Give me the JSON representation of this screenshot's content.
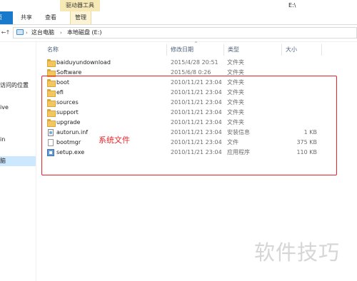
{
  "window": {
    "title": "E:\\",
    "contextual_group": "驱动器工具"
  },
  "ribbon": {
    "tabs": [
      {
        "label": "页"
      },
      {
        "label": "共享"
      },
      {
        "label": "查看"
      },
      {
        "label": "管理"
      }
    ],
    "colors": {
      "file_tab": "#1979ca",
      "contextual": "#f6e9b5"
    }
  },
  "address": {
    "back_arrow": "←",
    "up_arrow": "↑",
    "crumbs": [
      "这台电脑",
      "本地磁盘 (E:)"
    ]
  },
  "nav_pane": {
    "items": [
      {
        "label": "访问的位置"
      },
      {
        "label": "ive"
      },
      {
        "label": "in"
      },
      {
        "label": "脑",
        "selected": true
      }
    ]
  },
  "columns": [
    "名称",
    "修改日期",
    "类型",
    "大小"
  ],
  "files": [
    {
      "name": "baiduyundownload",
      "date": "2015/4/28 20:51",
      "type": "文件夹",
      "size": "",
      "icon": "folder-icon"
    },
    {
      "name": "Software",
      "date": "2015/6/8 0:26",
      "type": "文件夹",
      "size": "",
      "icon": "folder-icon"
    },
    {
      "name": "boot",
      "date": "2010/11/21 23:04",
      "type": "文件夹",
      "size": "",
      "icon": "folder-icon"
    },
    {
      "name": "efi",
      "date": "2010/11/21 23:04",
      "type": "文件夹",
      "size": "",
      "icon": "folder-icon"
    },
    {
      "name": "sources",
      "date": "2010/11/21 23:04",
      "type": "文件夹",
      "size": "",
      "icon": "folder-icon"
    },
    {
      "name": "support",
      "date": "2010/11/21 23:04",
      "type": "文件夹",
      "size": "",
      "icon": "folder-icon"
    },
    {
      "name": "upgrade",
      "date": "2010/11/21 23:04",
      "type": "文件夹",
      "size": "",
      "icon": "folder-icon"
    },
    {
      "name": "autorun.inf",
      "date": "2010/11/21 23:04",
      "type": "安装信息",
      "size": "1 KB",
      "icon": "inf-file-icon"
    },
    {
      "name": "bootmgr",
      "date": "2010/11/21 23:04",
      "type": "文件",
      "size": "375 KB",
      "icon": "file-icon"
    },
    {
      "name": "setup.exe",
      "date": "2010/11/21 23:04",
      "type": "应用程序",
      "size": "110 KB",
      "icon": "exe-icon"
    }
  ],
  "annotation": {
    "label": "系统文件",
    "color": "#e8242a"
  },
  "watermark": "软件技巧"
}
